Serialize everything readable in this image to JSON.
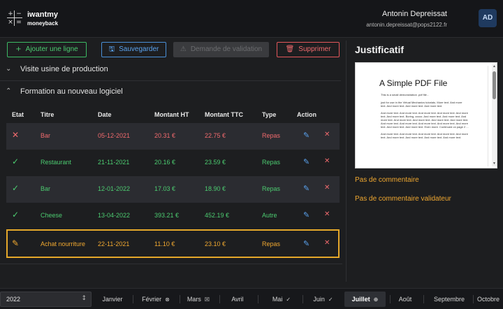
{
  "header": {
    "brand_top": "iwantmy",
    "brand_bottom": "moneyback",
    "user_name": "Antonin Depreissat",
    "user_email": "antonin.depreissat@pops2122.fr",
    "avatar_initials": "AD",
    "logo_symbols": [
      "+",
      "−",
      "×",
      "="
    ]
  },
  "toolbar": {
    "add_label": "Ajouter une ligne",
    "save_label": "Sauvegarder",
    "validate_label": "Demande de validation",
    "delete_label": "Supprimer"
  },
  "sections": [
    {
      "title": "Visite usine de production",
      "expanded": false
    },
    {
      "title": "Formation au nouveau logiciel",
      "expanded": true
    }
  ],
  "table": {
    "headers": [
      "Etat",
      "Titre",
      "Date",
      "Montant HT",
      "Montant TTC",
      "Type",
      "Action"
    ],
    "rows": [
      {
        "status": "rejected",
        "status_icon": "x-icon",
        "title": "Bar",
        "date": "05-12-2021",
        "ht": "20.31 €",
        "ttc": "22.75 €",
        "type": "Repas",
        "color": "#f06a6d"
      },
      {
        "status": "accepted",
        "status_icon": "check-icon",
        "title": "Restaurant",
        "date": "21-11-2021",
        "ht": "20.16 €",
        "ttc": "23.59 €",
        "type": "Repas",
        "color": "#4ccb70"
      },
      {
        "status": "accepted",
        "status_icon": "check-icon",
        "title": "Bar",
        "date": "12-01-2022",
        "ht": "17.03 €",
        "ttc": "18.90 €",
        "type": "Repas",
        "color": "#4ccb70"
      },
      {
        "status": "accepted",
        "status_icon": "check-icon",
        "title": "Cheese",
        "date": "13-04-2022",
        "ht": "393.21 €",
        "ttc": "452.19 €",
        "type": "Autre",
        "color": "#4ccb70"
      },
      {
        "status": "editing",
        "status_icon": "pencil-icon",
        "title": "Achat nourriture",
        "date": "22-11-2021",
        "ht": "11.10 €",
        "ttc": "23.10 €",
        "type": "Repas",
        "color": "#f0a830"
      }
    ]
  },
  "justificatif": {
    "title": "Justificatif",
    "pdf": {
      "title": "A Simple PDF File",
      "lines": [
        "This is a small demonstration .pdf file -",
        "just for use in the Virtual Mechanics tutorials. More text. And more",
        "text. And more text. And more text. And more text.",
        "And more text. And more text. And more text. And more text. And more",
        "text. And more text. Boring, zzzzz. And more text. And more text. And",
        "more text. And more text. And more text. And more text. And more text.",
        "And more text. And more text. And more text. And more text. And more",
        "text. And more text. And more text. Even more. Continued on page 2 ...",
        "And more text. And more text. And more text. And more text. And more",
        "text. And more text. And more text. And more text. And more text."
      ]
    },
    "comment": "Pas de commentaire",
    "validator_comment": "Pas de commentaire validateur"
  },
  "bottom": {
    "year": "2022",
    "months": [
      {
        "label": "Janvier",
        "icon": ""
      },
      {
        "label": "Février",
        "icon": "⊗"
      },
      {
        "label": "Mars",
        "icon": "☒"
      },
      {
        "label": "Avril",
        "icon": ""
      },
      {
        "label": "Mai",
        "icon": "✓"
      },
      {
        "label": "Juin",
        "icon": "✓"
      },
      {
        "label": "Juillet",
        "icon": "⊕",
        "active": true
      },
      {
        "label": "Août",
        "icon": ""
      },
      {
        "label": "Septembre",
        "icon": ""
      },
      {
        "label": "Octobre",
        "icon": ""
      }
    ]
  },
  "colors": {
    "background": "#1d1e20",
    "accent_green": "#4ccb70",
    "accent_blue": "#5aa2ee",
    "accent_red": "#f06a6d",
    "accent_orange": "#f0a830"
  }
}
